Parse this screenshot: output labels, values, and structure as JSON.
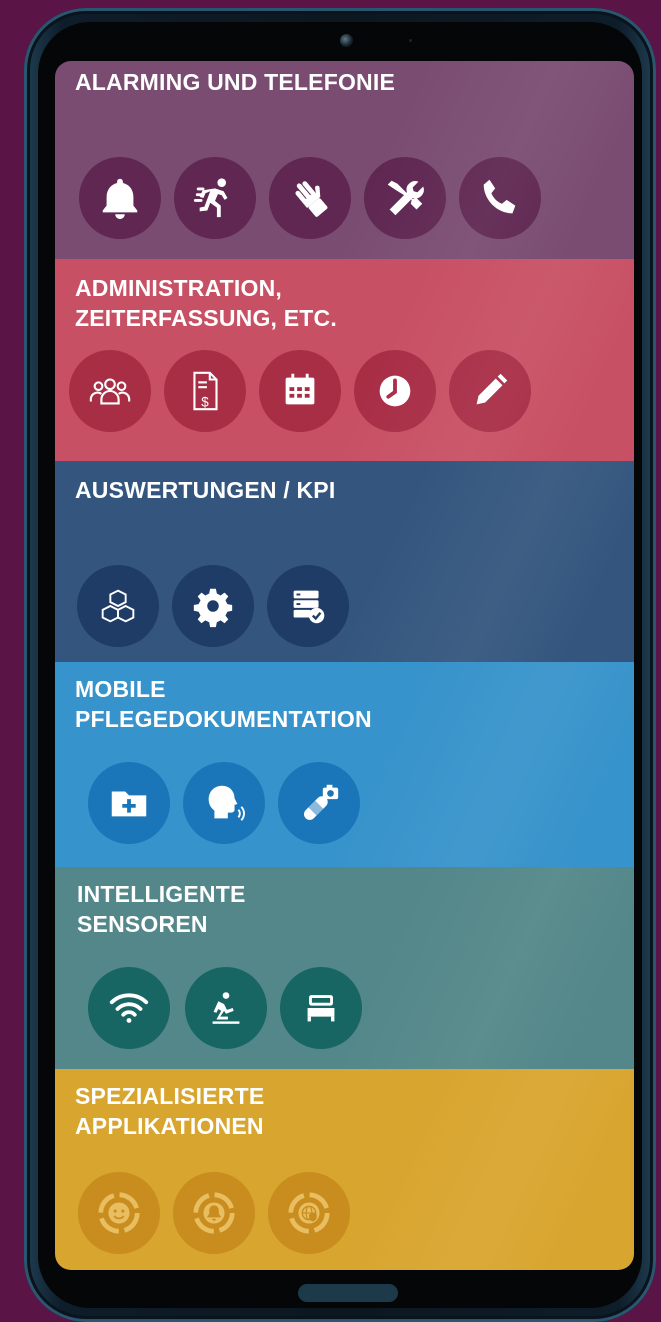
{
  "colors": {
    "background": "#5a1446",
    "alarming": "#7a4c72",
    "administration": "#c85064",
    "auswertungen": "#34567e",
    "pflegedoku": "#3793cb",
    "sensoren": "#538789",
    "spezial": "#d8a52e"
  },
  "sections": [
    {
      "title": "ALARMING UND TELEFONIE",
      "buttons": [
        "bell-icon",
        "running-person-icon",
        "hand-icon",
        "wrench-screwdriver-icon",
        "phone-icon"
      ]
    },
    {
      "title": "ADMINISTRATION,\nZEITERFASSUNG, ETC.",
      "buttons": [
        "users-group-icon",
        "invoice-dollar-icon",
        "calendar-icon",
        "clock-icon",
        "pencil-icon"
      ]
    },
    {
      "title": "AUSWERTUNGEN / KPI",
      "buttons": [
        "cubes-icon",
        "gear-icon",
        "server-check-icon"
      ]
    },
    {
      "title": "MOBILE\nPFLEGEDOKUMENTATION",
      "buttons": [
        "medical-folder-icon",
        "speaking-head-icon",
        "bandage-camera-icon"
      ]
    },
    {
      "title": "INTELLIGENTE\nSENSOREN",
      "buttons": [
        "wifi-icon",
        "person-falling-icon",
        "bed-icon"
      ]
    },
    {
      "title": "SPEZIALISIERTE\nAPPLIKATIONEN",
      "buttons": [
        "smiley-icon",
        "bell-target-icon",
        "globe-shield-icon"
      ]
    }
  ]
}
